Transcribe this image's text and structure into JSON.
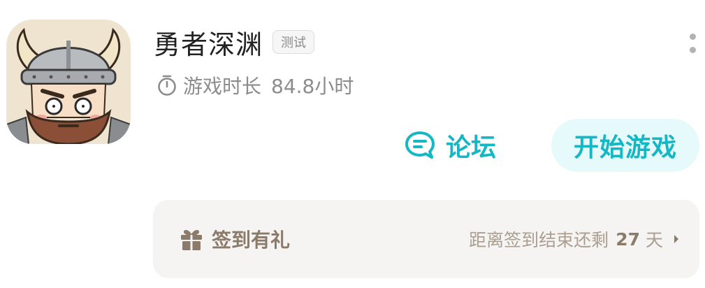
{
  "game": {
    "title": "勇者深渊",
    "badge": "测试",
    "icon": "viking-warrior-app-icon"
  },
  "playtime": {
    "label": "游戏时长",
    "value": "84.8小时",
    "icon": "timer-icon"
  },
  "actions": {
    "forum_label": "论坛",
    "forum_icon": "chat-bubble-icon",
    "start_label": "开始游戏"
  },
  "menu": {
    "icon": "more-vertical-icon"
  },
  "checkin": {
    "title": "签到有礼",
    "icon": "gift-icon",
    "remaining_prefix": "距离签到结束还剩",
    "remaining_days": "27",
    "remaining_unit": "天",
    "arrow_icon": "chevron-right-icon"
  },
  "colors": {
    "accent": "#14b8c4",
    "accent_bg": "#e6f9fb",
    "checkin_bg": "#f6f4f2",
    "checkin_text": "#8b7b6a",
    "secondary_text": "#8c8c8c"
  }
}
